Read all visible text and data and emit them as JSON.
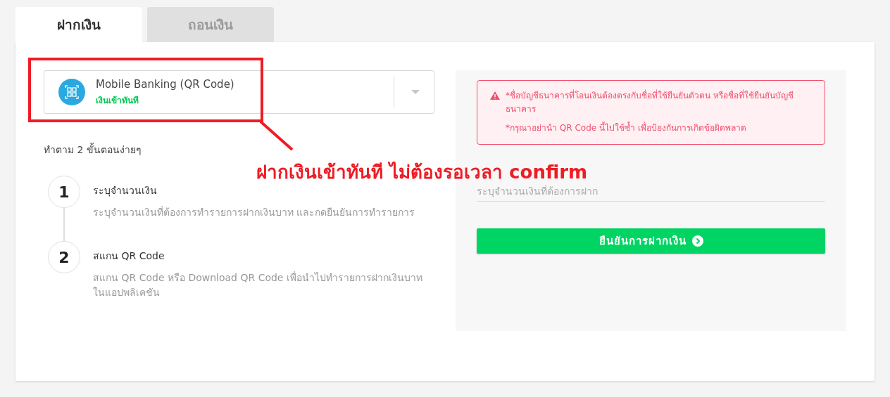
{
  "tabs": [
    {
      "label": "ฝากเงิน",
      "selected": true
    },
    {
      "label": "ถอนเงิน",
      "selected": false
    }
  ],
  "payment_method": {
    "name": "Mobile Banking (QR Code)",
    "note": "เงินเข้าทันที"
  },
  "steps_title": "ทำตาม 2 ขั้นตอนง่ายๆ",
  "steps": [
    {
      "number": "1",
      "title": "ระบุจำนวนเงิน",
      "description": "ระบุจำนวนเงินที่ต้องการทำรายการฝากเงินบาท และกดยืนยันการทำรายการ"
    },
    {
      "number": "2",
      "title": "สแกน QR Code",
      "description": "สแกน QR Code หรือ Download QR Code เพื่อนำไปทำรายการฝากเงินบาทในแอปพลิเคชัน"
    }
  ],
  "warnings": [
    "*ชื่อบัญชีธนาคารที่โอนเงินต้องตรงกับชื่อที่ใช้ยืนยันตัวตน หรือชื่อที่ใช้ยืนยันบัญชีธนาคาร",
    "*กรุณาอย่านำ QR Code นี้ไปใช้ซ้ำ เพื่อป้องกันการเกิดข้อผิดพลาด"
  ],
  "amount_field": {
    "placeholder": "ระบุจำนวนเงินที่ต้องการฝาก"
  },
  "confirm_button": "ยืนยันการฝากเงิน",
  "annotation": {
    "text": "ฝากเงินเข้าทันที ไม่ต้องรอเวลา confirm"
  }
}
